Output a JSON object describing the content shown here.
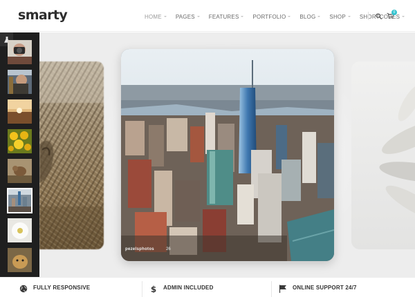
{
  "header": {
    "logo": "smarty",
    "nav": [
      {
        "label": "HOME",
        "active": true
      },
      {
        "label": "PAGES",
        "active": false
      },
      {
        "label": "FEATURES",
        "active": false
      },
      {
        "label": "PORTFOLIO",
        "active": false
      },
      {
        "label": "BLOG",
        "active": false
      },
      {
        "label": "SHOP",
        "active": false
      },
      {
        "label": "SHORTCODES",
        "active": false
      }
    ],
    "cart_count": "0"
  },
  "slider": {
    "thumbnails": [
      {
        "name": "camera-photographer"
      },
      {
        "name": "woman-portrait"
      },
      {
        "name": "sunset-landscape"
      },
      {
        "name": "yellow-flowers"
      },
      {
        "name": "squirrel"
      },
      {
        "name": "city-aerial",
        "active": true
      },
      {
        "name": "white-flower"
      },
      {
        "name": "dog"
      }
    ],
    "caption": {
      "author": "pezelsphotos",
      "likes": "26"
    }
  },
  "features": [
    {
      "title": "FULLY RESPONSIVE",
      "icon": "globe-icon"
    },
    {
      "title": "ADMIN INCLUDED",
      "icon": "dollar-icon"
    },
    {
      "title": "ONLINE SUPPORT 24/7",
      "icon": "flag-icon"
    }
  ],
  "colors": {
    "accent": "#34c3cf",
    "thumb_bg": "#1f1f1f",
    "slider_bg": "#ededed"
  }
}
